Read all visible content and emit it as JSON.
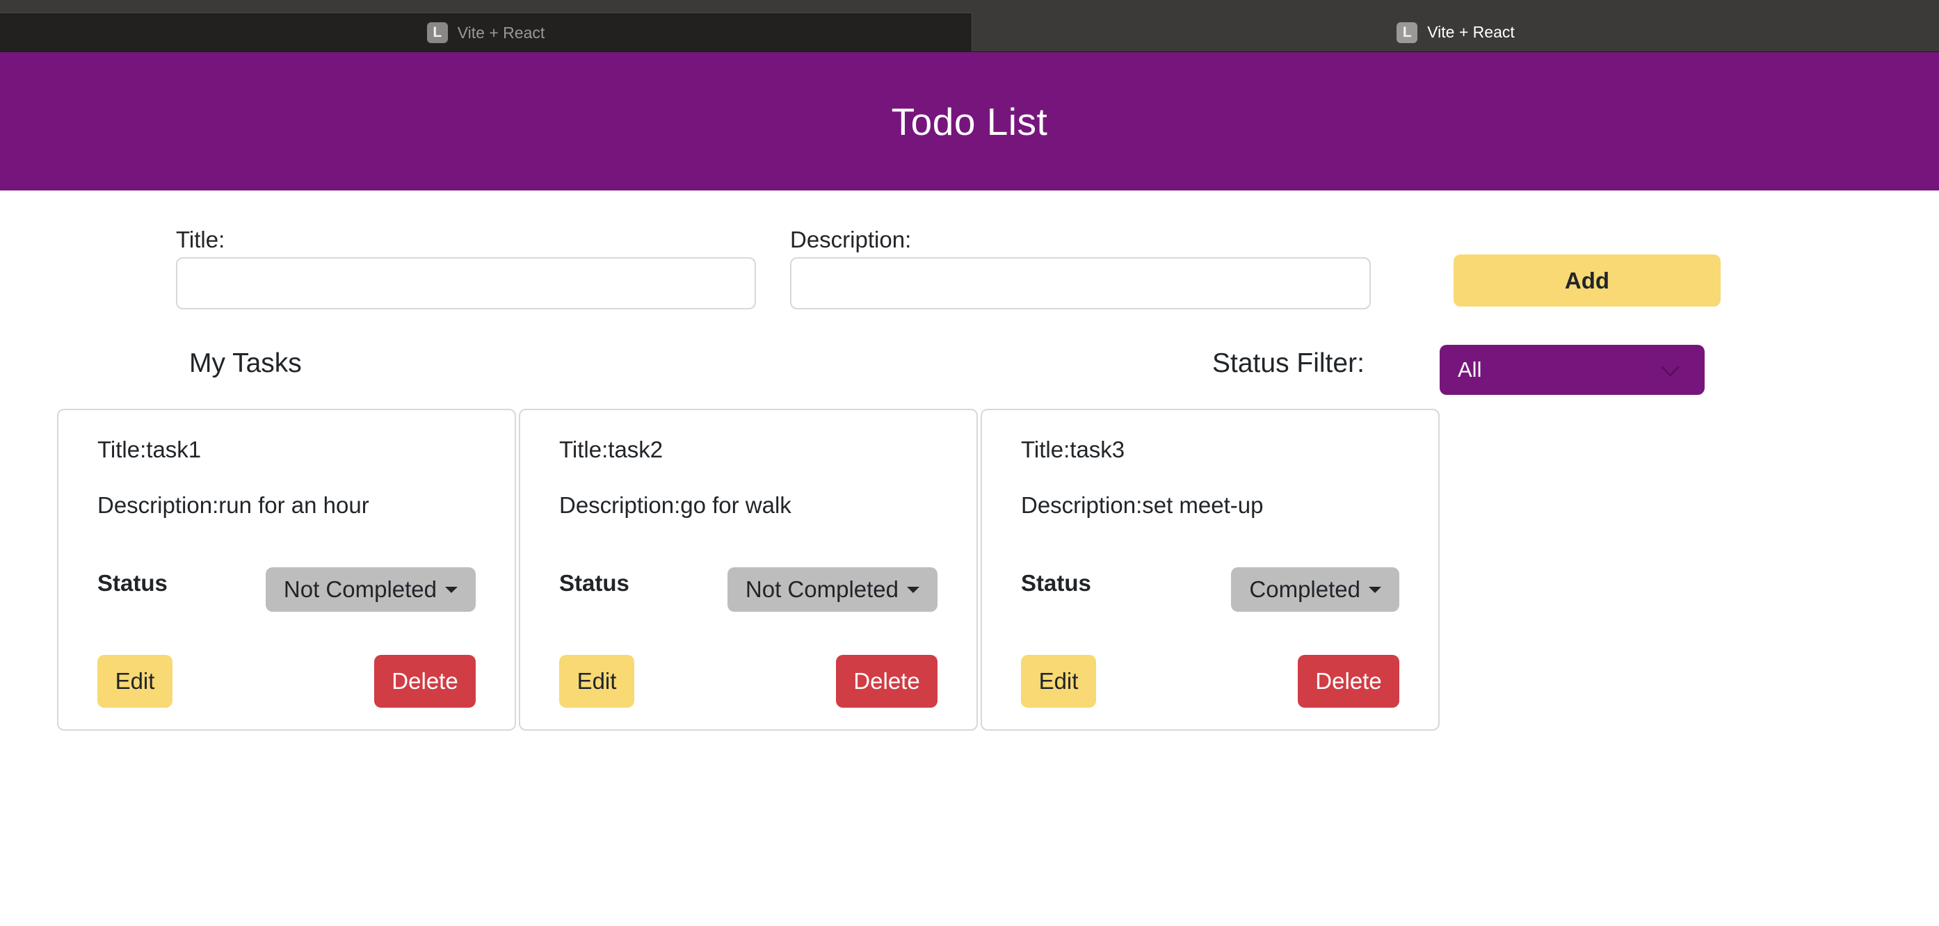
{
  "browser": {
    "tabs": [
      {
        "favicon": "L",
        "title": "Vite + React",
        "active": false
      },
      {
        "favicon": "L",
        "title": "Vite + React",
        "active": true
      }
    ]
  },
  "header": {
    "title": "Todo List",
    "background": "#76167c"
  },
  "form": {
    "title_label": "Title:",
    "title_value": "",
    "description_label": "Description:",
    "description_value": "",
    "add_label": "Add"
  },
  "tasks_section": {
    "heading": "My Tasks",
    "filter_label": "Status Filter:",
    "filter_value": "All"
  },
  "tasks": [
    {
      "title": "Title:task1",
      "description": "Description:run for an hour",
      "status_label": "Status",
      "status": "Not Completed",
      "edit_label": "Edit",
      "delete_label": "Delete"
    },
    {
      "title": "Title:task2",
      "description": "Description:go for walk",
      "status_label": "Status",
      "status": "Not Completed",
      "edit_label": "Edit",
      "delete_label": "Delete"
    },
    {
      "title": "Title:task3",
      "description": "Description:set meet-up",
      "status_label": "Status",
      "status": "Completed",
      "edit_label": "Edit",
      "delete_label": "Delete"
    }
  ],
  "colors": {
    "accent": "#76167c",
    "add": "#f8d974",
    "delete": "#d13d45",
    "status_button": "#bdbdbd"
  }
}
